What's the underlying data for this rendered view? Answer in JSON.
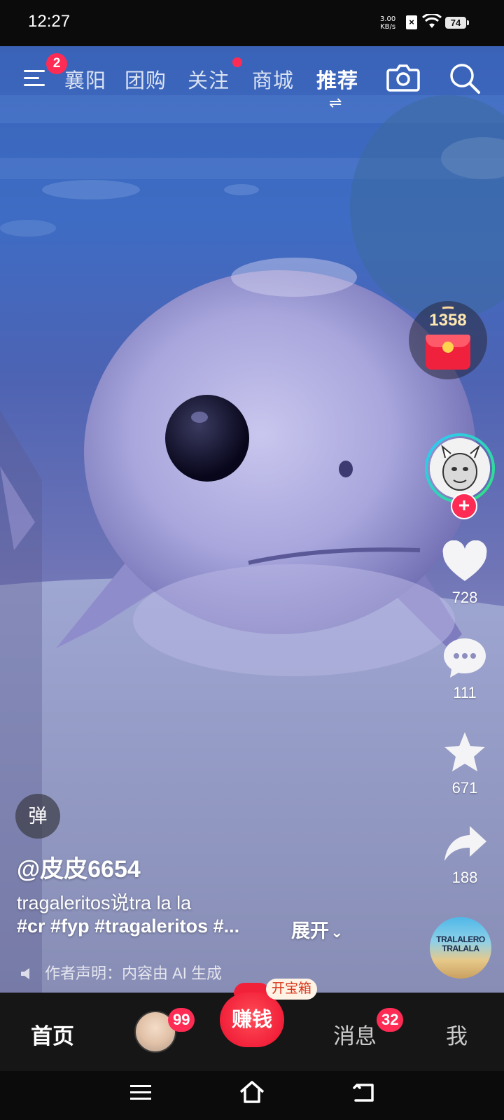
{
  "status_bar": {
    "time": "12:27",
    "net_speed_value": "3.00",
    "net_speed_unit": "KB/s",
    "battery": "74"
  },
  "top_nav": {
    "menu_badge": "2",
    "tabs": [
      {
        "label": "襄阳"
      },
      {
        "label": "团购"
      },
      {
        "label": "关注"
      },
      {
        "label": "商城"
      },
      {
        "label": "推荐"
      }
    ],
    "swap_glyph": "⇌"
  },
  "right_rail": {
    "red_packet_count": "1358",
    "likes": "728",
    "comments": "111",
    "favorites": "671",
    "shares": "188",
    "music_cover_text": "TRALALERO TRALALA"
  },
  "caption": {
    "danmu_label": "弹",
    "author": "@皮皮6654",
    "line1": "tragaleritos说tra la la",
    "hashtags": "#cr #fyp #tragaleritos #...",
    "expand_label": "展开",
    "expand_glyph": "⌄",
    "ai_notice": "作者声明：内容由 AI 生成"
  },
  "bottom_nav": {
    "home_label": "首页",
    "friends_badge": "99",
    "earn_label": "赚钱",
    "earn_tag": "开宝箱",
    "messages_label": "消息",
    "messages_badge": "32",
    "me_label": "我"
  },
  "colors": {
    "accent_red": "#fe2c55",
    "nav_background": "#161616"
  },
  "icons": [
    "menu-icon",
    "camera-icon",
    "search-icon",
    "heart-icon",
    "comment-icon",
    "star-icon",
    "share-icon",
    "speaker-icon",
    "nav-menu-icon",
    "nav-home-icon",
    "nav-back-icon"
  ]
}
